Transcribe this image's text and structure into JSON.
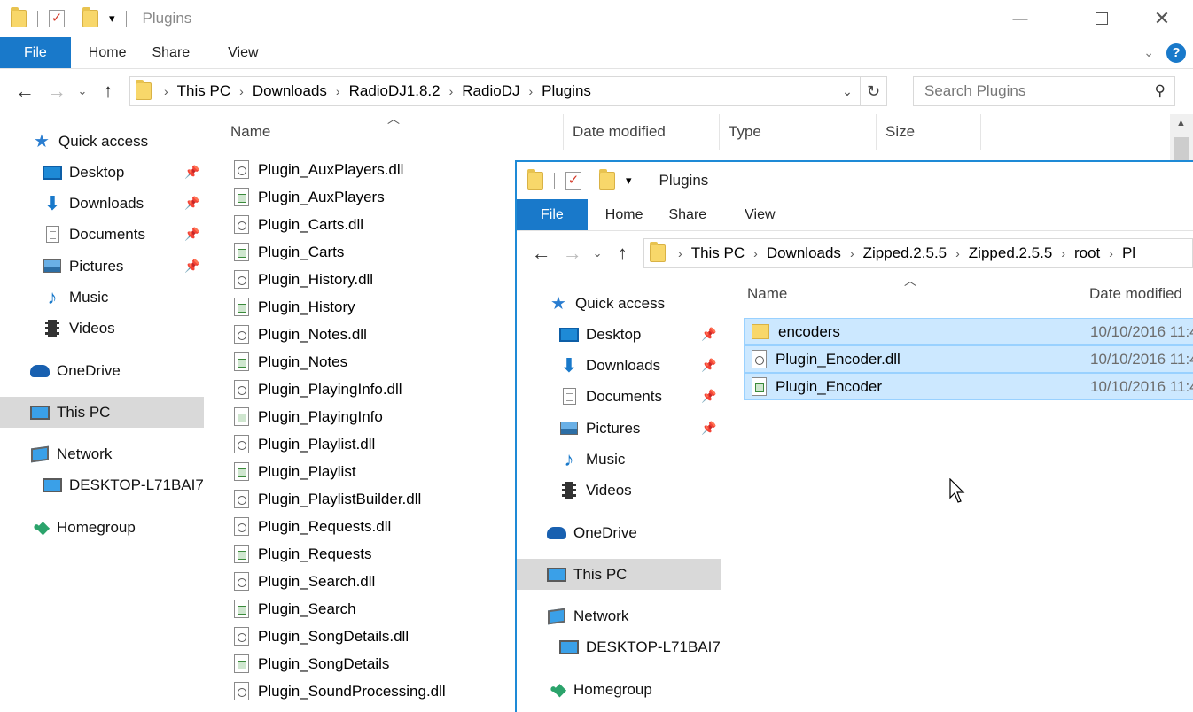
{
  "back_window": {
    "title": "Plugins",
    "ribbon_tabs": [
      "File",
      "Home",
      "Share",
      "View"
    ],
    "breadcrumb": [
      "This PC",
      "Downloads",
      "RadioDJ1.8.2",
      "RadioDJ",
      "Plugins"
    ],
    "search_placeholder": "Search Plugins",
    "columns": [
      "Name",
      "Date modified",
      "Type",
      "Size"
    ],
    "nav": {
      "quick_access": "Quick access",
      "pinned": [
        "Desktop",
        "Downloads",
        "Documents",
        "Pictures"
      ],
      "unpinned": [
        "Music",
        "Videos"
      ],
      "onedrive": "OneDrive",
      "this_pc": "This PC",
      "network": "Network",
      "network_child": "DESKTOP-L71BAI7",
      "homegroup": "Homegroup"
    },
    "files": [
      "Plugin_AuxPlayers.dll",
      "Plugin_AuxPlayers",
      "Plugin_Carts.dll",
      "Plugin_Carts",
      "Plugin_History.dll",
      "Plugin_History",
      "Plugin_Notes.dll",
      "Plugin_Notes",
      "Plugin_PlayingInfo.dll",
      "Plugin_PlayingInfo",
      "Plugin_Playlist.dll",
      "Plugin_Playlist",
      "Plugin_PlaylistBuilder.dll",
      "Plugin_Requests.dll",
      "Plugin_Requests",
      "Plugin_Search.dll",
      "Plugin_Search",
      "Plugin_SongDetails.dll",
      "Plugin_SongDetails",
      "Plugin_SoundProcessing.dll"
    ]
  },
  "front_window": {
    "title": "Plugins",
    "ribbon_tabs": [
      "File",
      "Home",
      "Share",
      "View"
    ],
    "breadcrumb": [
      "This PC",
      "Downloads",
      "Zipped.2.5.5",
      "Zipped.2.5.5",
      "root",
      "Pl"
    ],
    "columns": [
      "Name",
      "Date modified"
    ],
    "nav": {
      "quick_access": "Quick access",
      "pinned": [
        "Desktop",
        "Downloads",
        "Documents",
        "Pictures"
      ],
      "unpinned": [
        "Music",
        "Videos"
      ],
      "onedrive": "OneDrive",
      "this_pc": "This PC",
      "network": "Network",
      "network_child": "DESKTOP-L71BAI7",
      "homegroup": "Homegroup"
    },
    "files": [
      {
        "name": "encoders",
        "date": "10/10/2016 11:4",
        "kind": "folder"
      },
      {
        "name": "Plugin_Encoder.dll",
        "date": "10/10/2016 11:4",
        "kind": "dll"
      },
      {
        "name": "Plugin_Encoder",
        "date": "10/10/2016 11:4",
        "kind": "config"
      }
    ]
  },
  "icons": {
    "back": "back-arrow-icon",
    "forward": "forward-arrow-icon",
    "up": "up-arrow-icon",
    "refresh": "refresh-icon",
    "search": "search-icon",
    "help": "help-icon",
    "pin": "pin-icon"
  },
  "colors": {
    "accent": "#1979ca",
    "selection": "#cce8ff",
    "nav_selected": "#d9d9d9"
  }
}
